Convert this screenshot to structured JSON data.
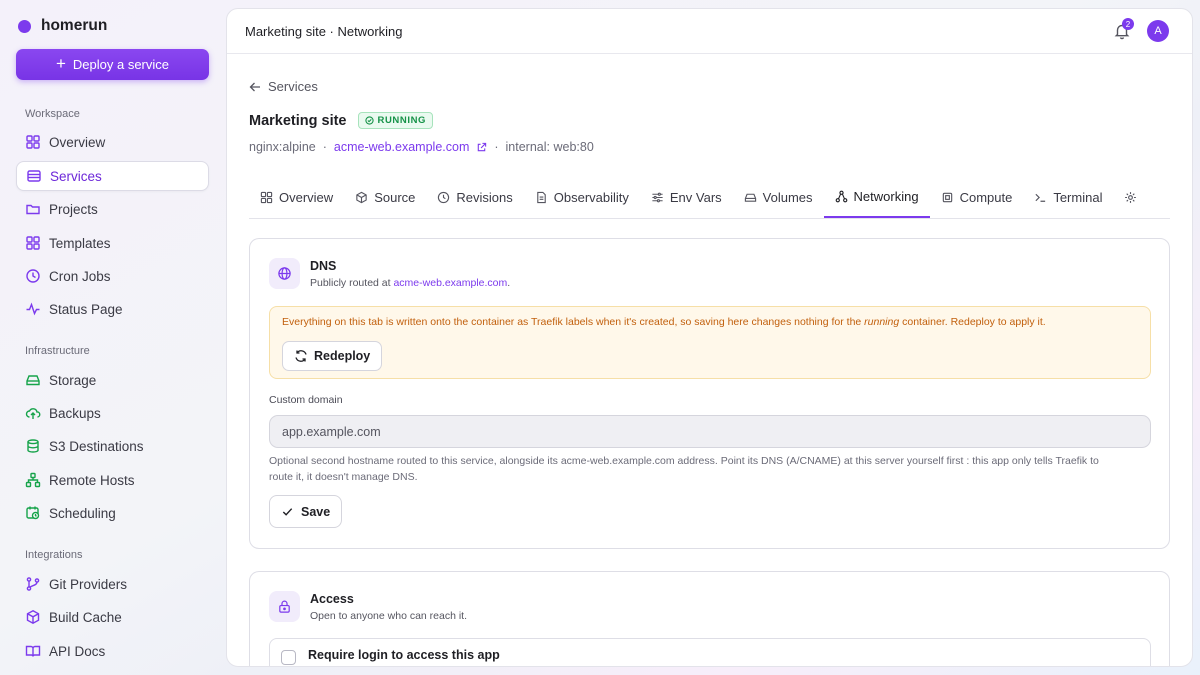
{
  "app": {
    "name": "homerun",
    "deploy_label": "Deploy a service"
  },
  "sidebar": {
    "groups": [
      {
        "label": "Workspace",
        "items": [
          {
            "label": "Overview",
            "icon": "grid-icon"
          },
          {
            "label": "Services",
            "icon": "layers-icon",
            "active": true
          },
          {
            "label": "Projects",
            "icon": "folder-icon"
          },
          {
            "label": "Templates",
            "icon": "templates-icon"
          },
          {
            "label": "Cron Jobs",
            "icon": "clock-icon"
          },
          {
            "label": "Status Page",
            "icon": "activity-icon"
          }
        ]
      },
      {
        "label": "Infrastructure",
        "items": [
          {
            "label": "Storage",
            "icon": "hard-drive-icon"
          },
          {
            "label": "Backups",
            "icon": "cloud-upload-icon"
          },
          {
            "label": "S3 Destinations",
            "icon": "database-icon"
          },
          {
            "label": "Remote Hosts",
            "icon": "network-icon"
          },
          {
            "label": "Scheduling",
            "icon": "calendar-clock-icon"
          }
        ]
      },
      {
        "label": "Integrations",
        "items": [
          {
            "label": "Git Providers",
            "icon": "git-branch-icon"
          },
          {
            "label": "Build Cache",
            "icon": "package-icon"
          },
          {
            "label": "API Docs",
            "icon": "book-icon"
          }
        ]
      }
    ]
  },
  "topbar": {
    "breadcrumb": "Marketing site · Networking",
    "notification_count": "2",
    "avatar_initial": "A"
  },
  "service": {
    "back_label": "Services",
    "name": "Marketing site",
    "status": "RUNNING",
    "image": "nginx:alpine",
    "domain": "acme-web.example.com",
    "internal": "internal: web:80",
    "separator": "·"
  },
  "tabs": [
    {
      "label": "Overview",
      "icon": "grid-icon"
    },
    {
      "label": "Source",
      "icon": "box-icon"
    },
    {
      "label": "Revisions",
      "icon": "history-icon"
    },
    {
      "label": "Observability",
      "icon": "file-text-icon"
    },
    {
      "label": "Env Vars",
      "icon": "sliders-icon"
    },
    {
      "label": "Volumes",
      "icon": "hard-drive-icon"
    },
    {
      "label": "Networking",
      "icon": "network-icon",
      "active": true
    },
    {
      "label": "Compute",
      "icon": "cpu-icon"
    },
    {
      "label": "Terminal",
      "icon": "terminal-icon"
    }
  ],
  "dns": {
    "title": "DNS",
    "subtitle_prefix": "Publicly routed at ",
    "subtitle_domain": "acme-web.example.com",
    "subtitle_suffix": ".",
    "warning_a": "Everything on this tab is written onto the container as Traefik labels when it's created, so saving here changes nothing for the ",
    "warning_em": "running",
    "warning_b": " container. Redeploy to apply it.",
    "redeploy_label": "Redeploy",
    "field_label": "Custom domain",
    "field_value": "app.example.com",
    "help_line1": "Optional second hostname routed to this service, alongside its acme-web.example.com address. Point its DNS (A/CNAME) at this server yourself first : this app only tells Traefik to",
    "help_line2": "route it, it doesn't manage DNS.",
    "save_label": "Save"
  },
  "access": {
    "title": "Access",
    "subtitle": "Open to anyone who can reach it.",
    "login_label": "Require login to access this app"
  },
  "colors": {
    "accent": "#7c3aed",
    "running": "#169248",
    "warning_text": "#c2600d"
  }
}
